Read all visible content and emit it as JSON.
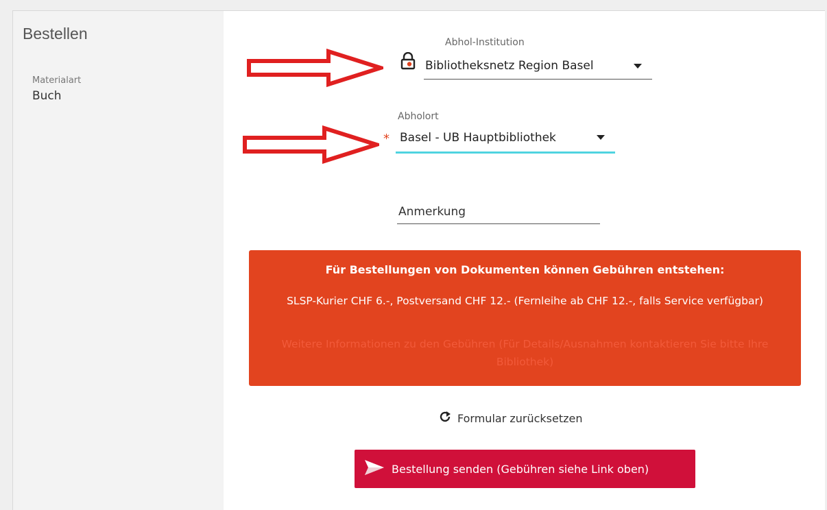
{
  "sidebar": {
    "title": "Bestellen",
    "material_label": "Materialart",
    "material_value": "Buch"
  },
  "form": {
    "institution": {
      "label": "Abhol-Institution",
      "value": "Bibliotheksnetz Region Basel"
    },
    "pickup": {
      "label": "Abholort",
      "value": "Basel - UB Hauptbibliothek",
      "required_mark": "*"
    },
    "note": {
      "label": "Anmerkung"
    }
  },
  "notice": {
    "title": "Für Bestellungen von Dokumenten können Gebühren entstehen:",
    "body": "SLSP-Kurier CHF 6.-, Postversand CHF 12.- (Fernleihe ab CHF 12.-, falls Service verfügbar)",
    "link": "Weitere Informationen zu den Gebühren (Für Details/Ausnahmen kontaktieren Sie bitte Ihre Bibliothek)"
  },
  "actions": {
    "reset_label": "Formular zurücksetzen",
    "send_label": "Bestellung senden (Gebühren siehe Link oben)"
  },
  "colors": {
    "notice_bg": "#e2441f",
    "send_bg": "#d0103a",
    "focus_underline": "#4fd3e0",
    "annotation_arrow": "#e02020"
  },
  "icons": {
    "lock": "lock-icon",
    "caret": "caret-down-icon",
    "reset": "refresh-icon",
    "send": "paper-plane-icon"
  }
}
